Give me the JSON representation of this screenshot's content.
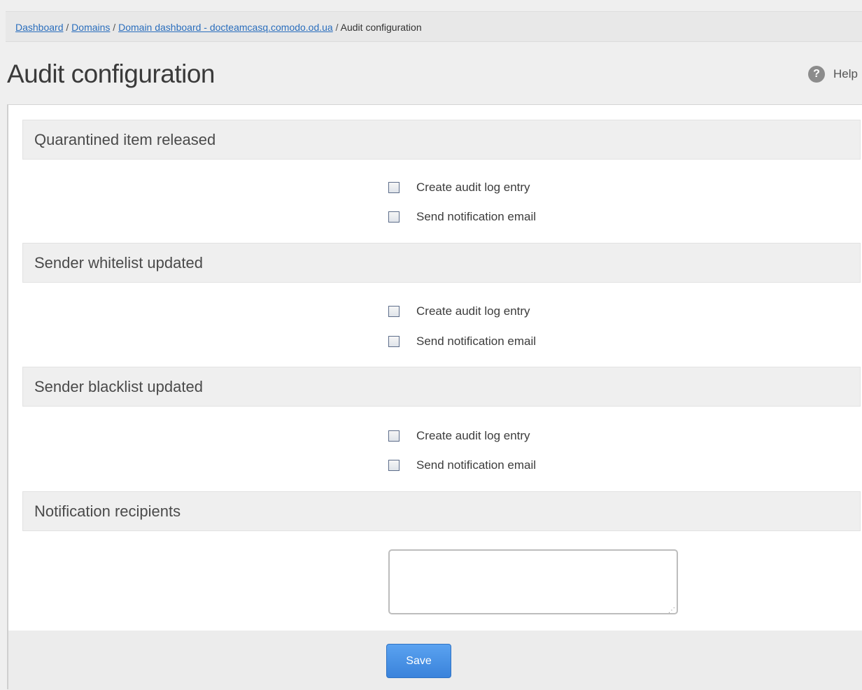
{
  "breadcrumb": {
    "items": [
      {
        "label": "Dashboard"
      },
      {
        "label": "Domains"
      },
      {
        "label": "Domain dashboard - docteamcasq.comodo.od.ua"
      },
      {
        "label": "Audit configuration"
      }
    ],
    "separator": " / "
  },
  "header": {
    "title": "Audit configuration",
    "help_label": "Help",
    "help_icon": "question-circle-icon"
  },
  "sections": [
    {
      "title": "Quarantined item released",
      "options": [
        {
          "label": "Create audit log entry",
          "checked": false
        },
        {
          "label": "Send notification email",
          "checked": false
        }
      ]
    },
    {
      "title": "Sender whitelist updated",
      "options": [
        {
          "label": "Create audit log entry",
          "checked": false
        },
        {
          "label": "Send notification email",
          "checked": false
        }
      ]
    },
    {
      "title": "Sender blacklist updated",
      "options": [
        {
          "label": "Create audit log entry",
          "checked": false
        },
        {
          "label": "Send notification email",
          "checked": false
        }
      ]
    }
  ],
  "recipients": {
    "title": "Notification recipients",
    "value": ""
  },
  "footer": {
    "save_label": "Save"
  },
  "colors": {
    "link": "#2a6ebd",
    "save_button": "#3a83db",
    "section_header_bg": "#efefef"
  }
}
